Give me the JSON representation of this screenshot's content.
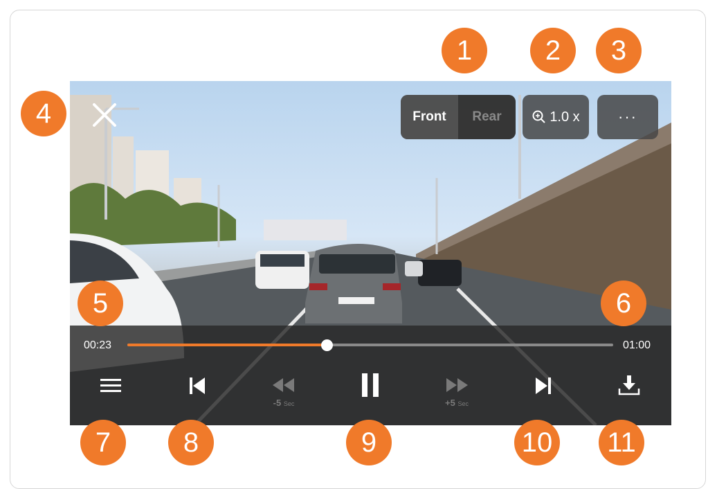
{
  "badges": [
    "1",
    "2",
    "3",
    "4",
    "5",
    "6",
    "7",
    "8",
    "9",
    "10",
    "11"
  ],
  "camera_toggle": {
    "front_label": "Front",
    "rear_label": "Rear",
    "selected": "Front"
  },
  "zoom": {
    "label": "1.0 x"
  },
  "more": {
    "label": "···"
  },
  "playback": {
    "current_time": "00:23",
    "total_time": "01:00",
    "progress": 0.41
  },
  "skip_back": {
    "value": "-5",
    "unit": "Sec"
  },
  "skip_forward": {
    "value": "+5",
    "unit": "Sec"
  },
  "icons": {
    "close": "close-icon",
    "zoom": "zoom-in-icon",
    "list": "hamburger-icon",
    "previous": "skip-previous-icon",
    "rewind": "rewind-icon",
    "pause": "pause-icon",
    "fast_forward": "fast-forward-icon",
    "next": "skip-next-icon",
    "download": "download-icon"
  },
  "colors": {
    "accent": "#f07a2a",
    "panel": "#282828",
    "disabled": "#7a7a7a"
  }
}
